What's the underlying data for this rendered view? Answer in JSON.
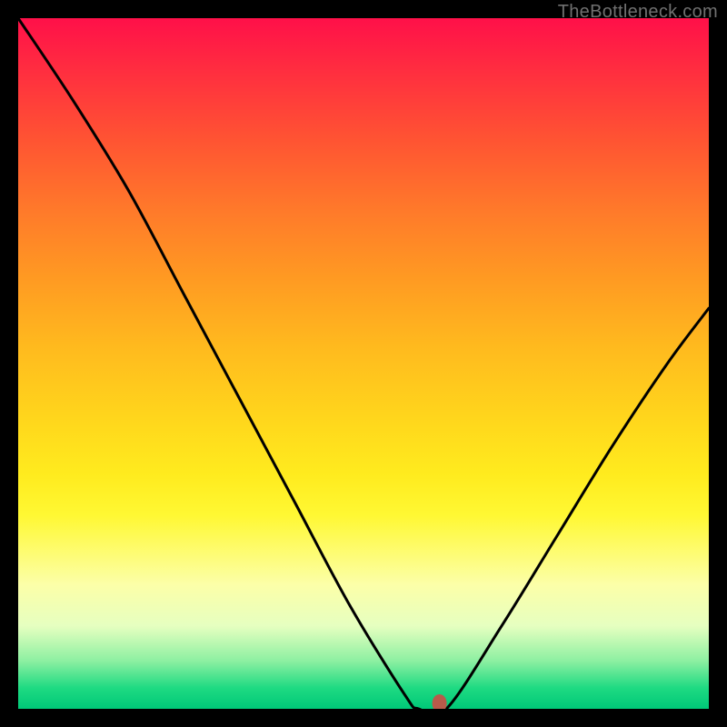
{
  "watermark": "TheBottleneck.com",
  "chart_data": {
    "type": "line",
    "title": "",
    "xlabel": "",
    "ylabel": "",
    "xlim": [
      0,
      100
    ],
    "ylim": [
      0,
      100
    ],
    "grid": false,
    "legend": false,
    "background": "rainbow-gradient-vertical",
    "series": [
      {
        "name": "bottleneck-curve",
        "x": [
          0,
          8,
          16,
          24,
          32,
          40,
          48,
          56,
          58,
          62,
          70,
          78,
          86,
          94,
          100
        ],
        "values": [
          100,
          88,
          75,
          60,
          45,
          30,
          15,
          2,
          0,
          0,
          12,
          25,
          38,
          50,
          58
        ]
      }
    ],
    "marker": {
      "name": "optimal-point",
      "x": 61,
      "y": 0,
      "color": "#b85a4a"
    }
  }
}
